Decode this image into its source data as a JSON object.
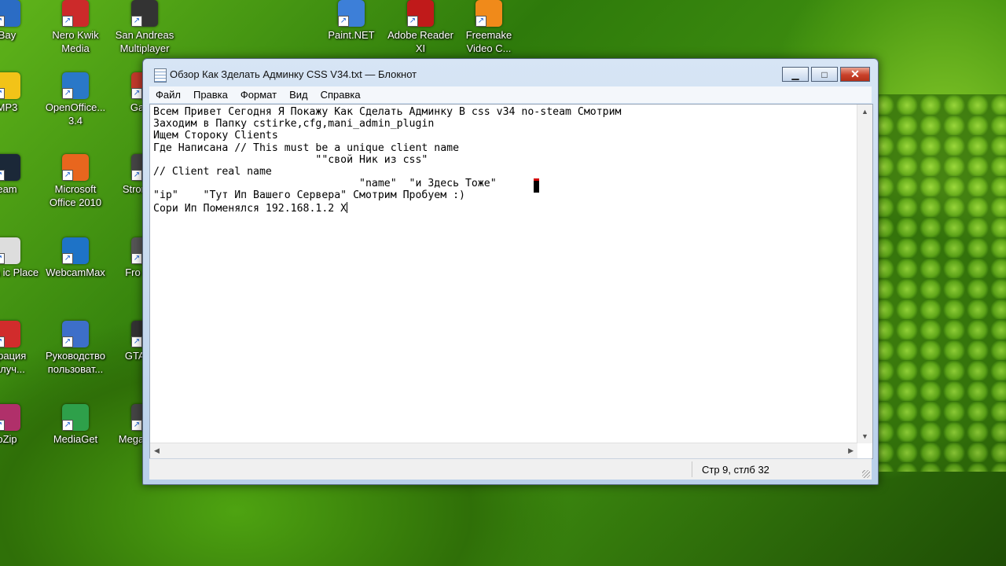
{
  "desktop": {
    "icons": [
      {
        "label": "Bay",
        "color": "#2b6cc4"
      },
      {
        "label": "Nero Kwik Media",
        "color": "#cc2a2a"
      },
      {
        "label": "San Andreas Multiplayer",
        "color": "#333333"
      },
      {
        "label": "Paint.NET",
        "color": "#3d7fd8"
      },
      {
        "label": "Adobe Reader XI",
        "color": "#c01a1a"
      },
      {
        "label": "Freemake Video C...",
        "color": "#f08a1a"
      },
      {
        "label": "MP3",
        "color": "#f2c318"
      },
      {
        "label": "OpenOffice... 3.4",
        "color": "#2a78c8"
      },
      {
        "label": "Garen",
        "color": "#c0392b"
      },
      {
        "label": "eam",
        "color": "#1b2838"
      },
      {
        "label": "Microsoft Office 2010",
        "color": "#e8661e"
      },
      {
        "label": "Stron Leg",
        "color": "#444444"
      },
      {
        "label": "shiba ic Place",
        "color": "#dddddd"
      },
      {
        "label": "WebcamMax",
        "color": "#1e73c7"
      },
      {
        "label": "Fro Thro",
        "color": "#555555"
      },
      {
        "label": "страция получ...",
        "color": "#d12c2c"
      },
      {
        "label": "Руководство пользоват...",
        "color": "#3d6fc9"
      },
      {
        "label": "GTA Anc",
        "color": "#333333"
      },
      {
        "label": "oZip",
        "color": "#b0306a"
      },
      {
        "label": "MediaGet",
        "color": "#2ea04a"
      },
      {
        "label": "Mega eXpe",
        "color": "#444444"
      }
    ]
  },
  "window": {
    "title": "Обзор Как Зделать Админку CSS V34.txt — Блокнот",
    "buttons": {
      "minimize": "▁",
      "maximize": "□",
      "close": "✕"
    },
    "menu": [
      "Файл",
      "Правка",
      "Формат",
      "Вид",
      "Справка"
    ],
    "lines": [
      "Всем Привет Сегодня Я Покажу Как Сделать Админку В css v34 no-steam Смотрим",
      "Заходим в Папку cstirke,cfg,mani_admin_plugin",
      "Ищем Стороку Clients",
      "Где Написана // This must be a unique client name",
      "                          \"\"свой Ник из css\"",
      "// Client real name",
      "                                 \"name\"  \"и Здесь Тоже\"",
      "\"ip\"    \"Тут Ип Вашего Сервера\" Смотрим Пробуем :)",
      "Сори Ип Поменялся 192.168.1.2 X"
    ],
    "status": "Стр 9, стлб 32"
  }
}
